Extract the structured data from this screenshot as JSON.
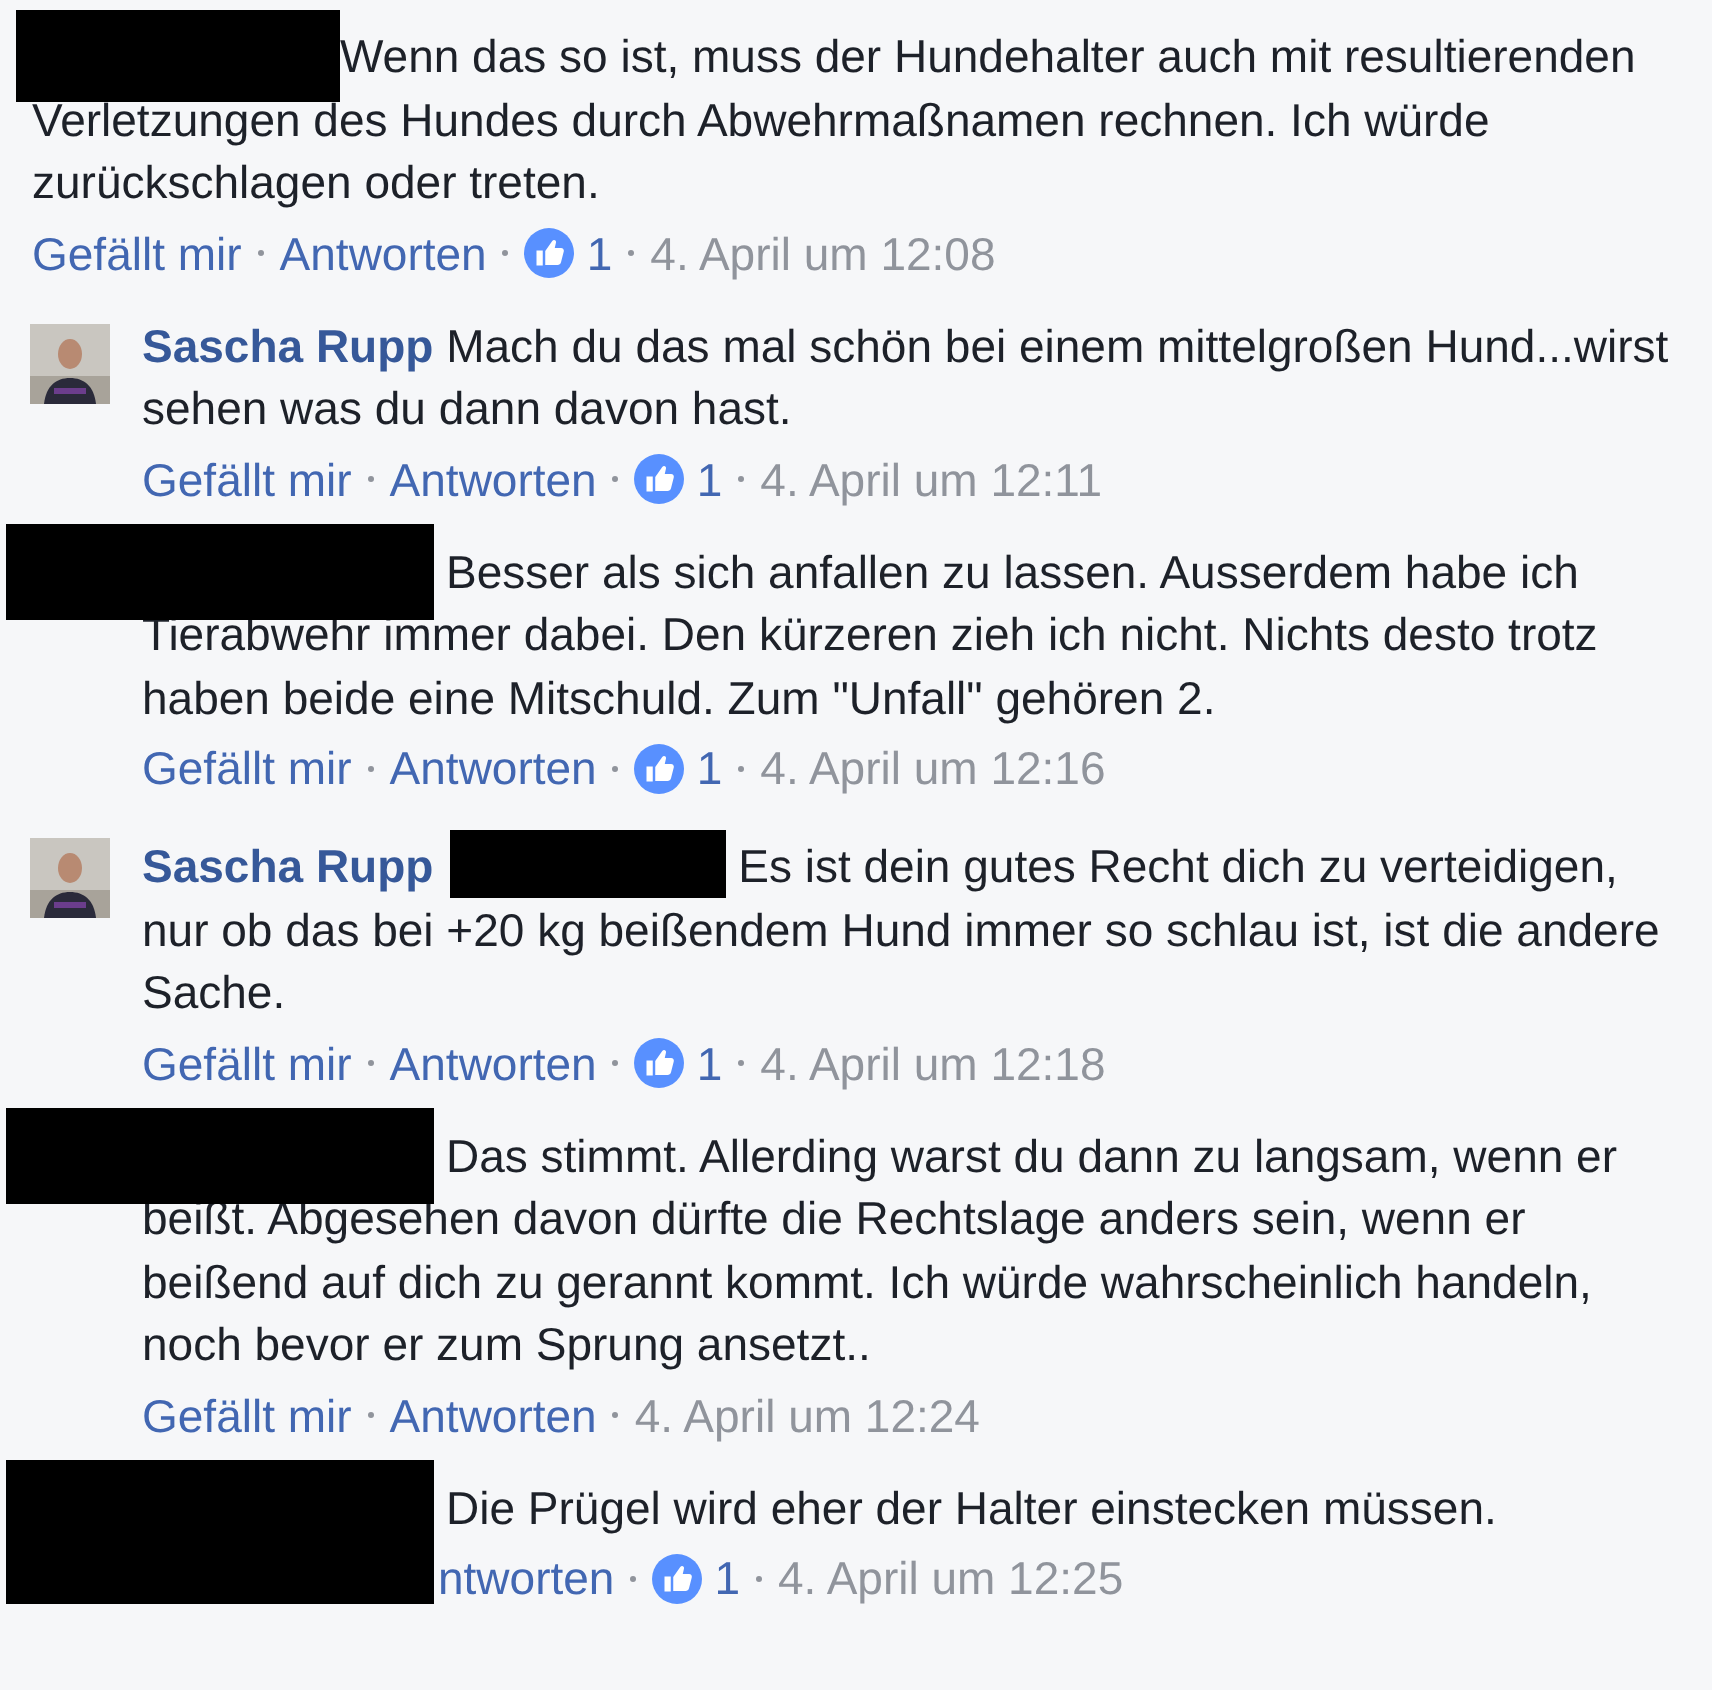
{
  "comment": {
    "author_redacted": true,
    "text": "Wenn das so ist, muss der Hundehalter auch mit resultierenden Verletzungen des Hundes durch Abwehrmaßnamen rechnen. Ich würde zurückschlagen oder treten.",
    "actions": [
      "Gefällt mir",
      "Antworten"
    ],
    "likes": "1",
    "time": "4. April um 12:08",
    "children": [
      {
        "author_redacted": false,
        "author": "Sascha Rupp",
        "text": "Mach du das mal schön bei einem mittelgroßen Hund...wirst sehen was du dann davon hast.",
        "actions": [
          "Gefällt mir",
          "Antworten"
        ],
        "likes": "1",
        "time": "4. April um 12:11"
      },
      {
        "author_redacted": true,
        "text": "Besser als sich anfallen zu lassen. Ausserdem habe ich Tierabwehr immer dabei. Den kürzeren zieh ich nicht. Nichts desto trotz haben beide eine Mitschuld. Zum \"Unfall\" gehören 2.",
        "actions": [
          "Gefällt mir",
          "Antworten"
        ],
        "likes": "1",
        "time": "4. April um 12:16"
      },
      {
        "author_redacted": false,
        "author": "Sascha Rupp",
        "mention_redacted": true,
        "text": "Es ist dein gutes Recht dich zu verteidigen, nur ob das bei +20 kg beißendem Hund immer so schlau ist, ist die andere Sache.",
        "actions": [
          "Gefällt mir",
          "Antworten"
        ],
        "likes": "1",
        "time": "4. April um 12:18"
      },
      {
        "author_redacted": true,
        "text": "Das stimmt. Allerding warst du dann zu langsam, wenn er beißt. Abgesehen davon dürfte die Rechtslage anders sein, wenn er beißend auf dich zu gerannt kommt. Ich würde wahrscheinlich handeln, noch bevor er zum Sprung ansetzt..",
        "actions": [
          "Gefällt mir",
          "Antworten"
        ],
        "time": "4. April um 12:24"
      },
      {
        "author_redacted": true,
        "covers_actions": true,
        "text": "Die Prügel wird eher der Halter einstecken müssen.",
        "actions": [
          "ntworten"
        ],
        "likes": "1",
        "time": "4. April um 12:25"
      }
    ]
  }
}
